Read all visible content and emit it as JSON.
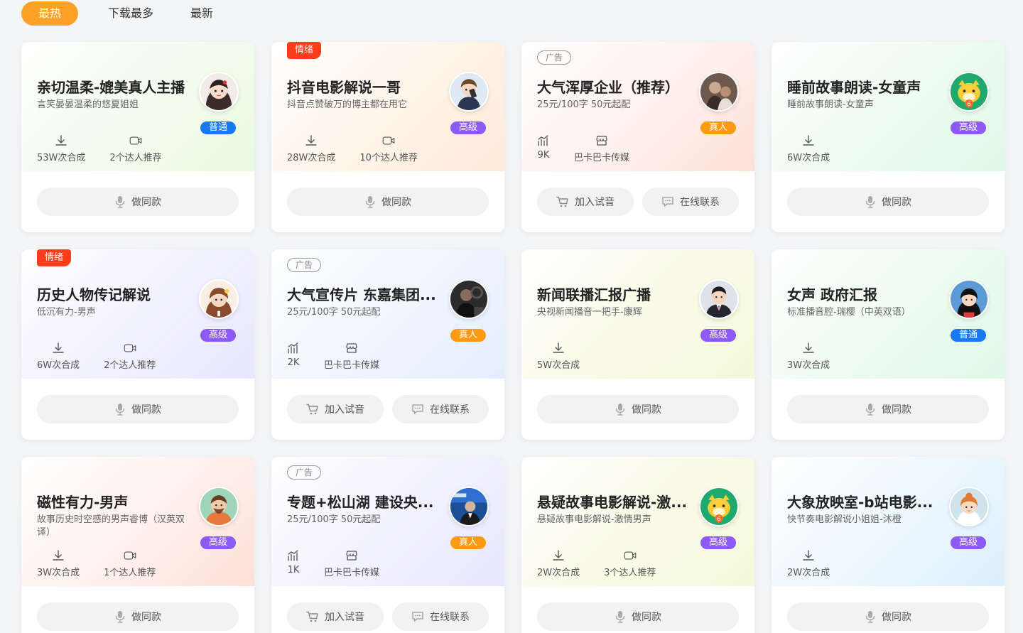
{
  "tabs": [
    "最热",
    "下载最多",
    "最新"
  ],
  "colors": {
    "accent": "#ffa127",
    "emotion_tag": "#fa3e1b",
    "level_normal": "#1a78f2",
    "level_high": "#8e5af7",
    "level_real": "#ff9a15"
  },
  "cards": [
    {
      "title": "亲切温柔-媲美真人主播",
      "sub": "言笑晏晏温柔的悠夏姐姐",
      "badge": "普通",
      "stat1": "53W次合成",
      "stat2": "2个达人推荐",
      "btn": "做同款"
    },
    {
      "tag": "情绪",
      "title": "抖音电影解说一哥",
      "sub": "抖音点赞破万的博主都在用它",
      "badge": "高级",
      "stat1": "28W次合成",
      "stat2": "10个达人推荐",
      "btn": "做同款"
    },
    {
      "tag": "广告",
      "title": "大气浑厚企业（推荐）",
      "sub": "25元/100字 50元起配",
      "badge": "真人",
      "stat1": "9K",
      "stat2": "巴卡巴卡传媒",
      "btn1": "加入试音",
      "btn2": "在线联系"
    },
    {
      "title": "睡前故事朗读-女童声",
      "sub": "睡前故事朗读-女童声",
      "badge": "高级",
      "stat1": "6W次合成",
      "btn": "做同款"
    },
    {
      "tag": "情绪",
      "title": "历史人物传记解说",
      "sub": "低沉有力-男声",
      "badge": "高级",
      "stat1": "6W次合成",
      "stat2": "2个达人推荐",
      "btn": "做同款"
    },
    {
      "tag": "广告",
      "title": "大气宣传片 东嘉集团...",
      "sub": "25元/100字 50元起配",
      "badge": "真人",
      "stat1": "2K",
      "stat2": "巴卡巴卡传媒",
      "btn1": "加入试音",
      "btn2": "在线联系"
    },
    {
      "title": "新闻联播汇报广播",
      "sub": "央视新闻播音一把手-康辉",
      "badge": "高级",
      "stat1": "5W次合成",
      "btn": "做同款"
    },
    {
      "title": "女声 政府汇报",
      "sub": "标准播音腔-瑞樱（中英双语）",
      "badge": "普通",
      "stat1": "3W次合成",
      "btn": "做同款"
    },
    {
      "title": "磁性有力-男声",
      "sub": "故事历史时空感的男声睿博（汉英双译）",
      "badge": "高级",
      "stat1": "3W次合成",
      "stat2": "1个达人推荐",
      "btn": "做同款"
    },
    {
      "tag": "广告",
      "title": "专题+松山湖 建设央...",
      "sub": "25元/100字 50元起配",
      "badge": "真人",
      "stat1": "1K",
      "stat2": "巴卡巴卡传媒",
      "btn1": "加入试音",
      "btn2": "在线联系"
    },
    {
      "title": "悬疑故事电影解说-激...",
      "sub": "悬疑故事电影解说-激情男声",
      "badge": "高级",
      "stat1": "2W次合成",
      "stat2": "3个达人推荐",
      "btn": "做同款"
    },
    {
      "title": "大象放映室-b站电影...",
      "sub": "快节奏电影解说小姐姐-沐橙",
      "badge": "高级",
      "stat1": "2W次合成",
      "btn": "做同款"
    }
  ]
}
